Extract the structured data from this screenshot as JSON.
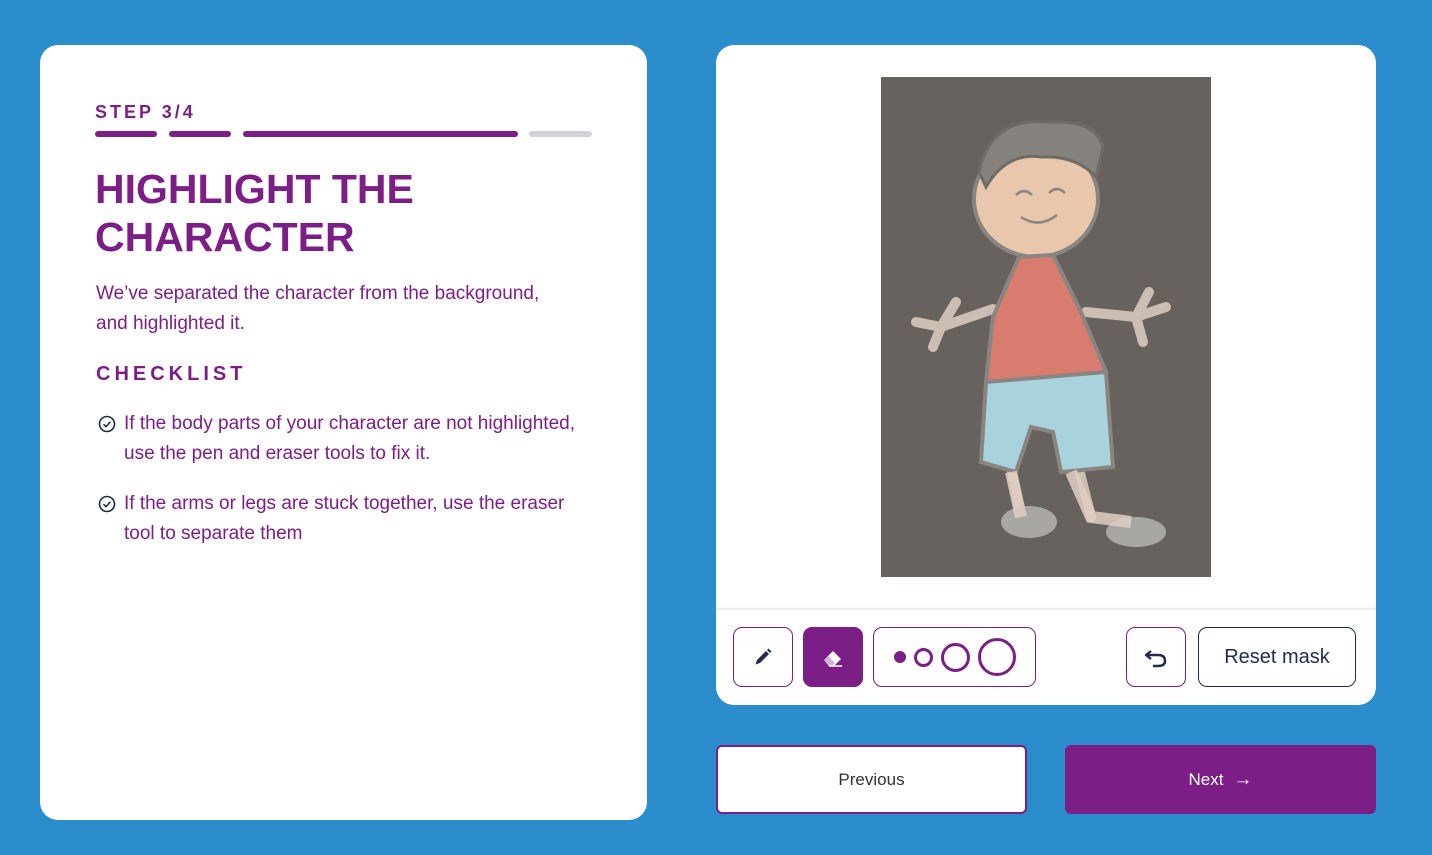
{
  "step": {
    "label": "STEP 3/4",
    "current": 3,
    "total": 4,
    "progress_fraction": 0.75
  },
  "heading": "HIGHLIGHT THE CHARACTER",
  "description": "We’ve separated the character from the background, and highlighted it.",
  "checklist": {
    "title": "CHECKLIST",
    "items": [
      "If the body parts of your character are not highlighted, use the pen and eraser tools to fix it.",
      "If the arms or legs are stuck together, use the eraser tool to separate them"
    ]
  },
  "toolbar": {
    "pen_icon": "pencil-icon",
    "eraser_icon": "eraser-icon",
    "selected_tool": "eraser",
    "brush_sizes": [
      "small",
      "medium",
      "large",
      "extra-large"
    ],
    "undo_icon": "undo-icon",
    "reset_label": "Reset mask"
  },
  "navigation": {
    "previous_label": "Previous",
    "next_label": "Next",
    "next_icon": "arrow-right-icon"
  },
  "colors": {
    "background": "#2b8dcb",
    "accent": "#7b1f86",
    "dark_text": "#1d2c4c"
  }
}
